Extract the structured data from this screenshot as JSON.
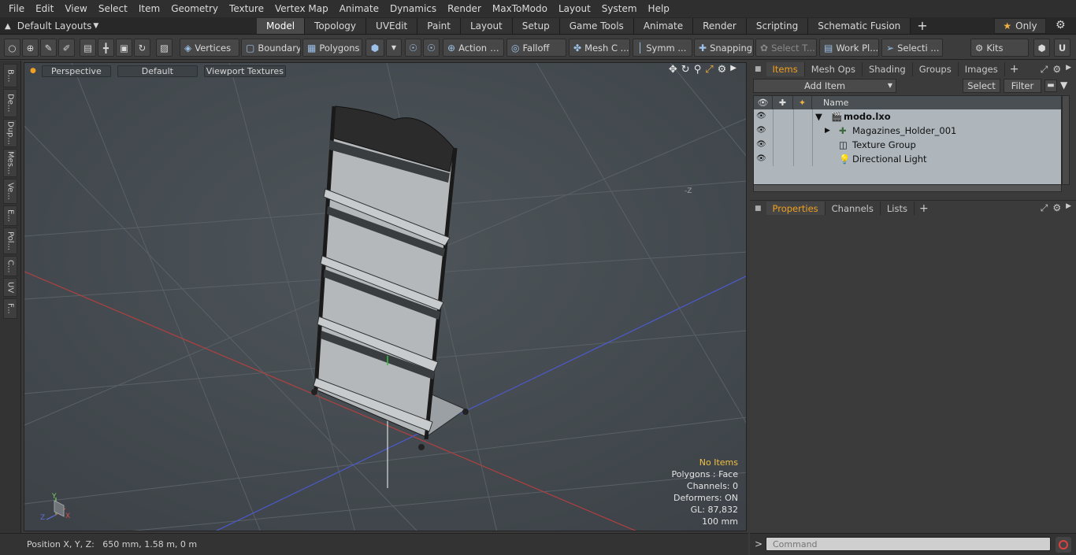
{
  "menu": [
    "File",
    "Edit",
    "View",
    "Select",
    "Item",
    "Geometry",
    "Texture",
    "Vertex Map",
    "Animate",
    "Dynamics",
    "Render",
    "MaxToModo",
    "Layout",
    "System",
    "Help"
  ],
  "layout": {
    "preset": "Default Layouts",
    "tabs": [
      "Model",
      "Topology",
      "UVEdit",
      "Paint",
      "Layout",
      "Setup",
      "Game Tools",
      "Animate",
      "Render",
      "Scripting",
      "Schematic Fusion"
    ],
    "active_tab": "Model",
    "only_label": "Only"
  },
  "toolbar": {
    "vertices": "Vertices",
    "boundary": "Boundary",
    "polygons": "Polygons",
    "action": "Action",
    "falloff": "Falloff",
    "mesh": "Mesh C ...",
    "symm": "Symm ...",
    "snapping": "Snapping",
    "select_t": "Select T...",
    "work_pl": "Work Pl...",
    "selecti": "Selecti ...",
    "kits": "Kits"
  },
  "left_tabs": [
    "B...",
    "De...",
    "Dup...",
    "Mes...",
    "Ve...",
    "E...",
    "Pol...",
    "C...",
    "UV",
    "F..."
  ],
  "viewport": {
    "view_mode": "Perspective",
    "shading": "Default",
    "textures": "Viewport Textures",
    "info": {
      "items": "No Items",
      "polygons": "Polygons : Face",
      "channels": "Channels: 0",
      "deformers": "Deformers: ON",
      "gl": "GL: 87,832",
      "scale": "100 mm"
    }
  },
  "status": "Position X, Y, Z:   650 mm, 1.58 m, 0 m",
  "items_panel": {
    "tabs": [
      "Items",
      "Mesh Ops",
      "Shading",
      "Groups",
      "Images"
    ],
    "add_item": "Add Item",
    "select": "Select",
    "filter": "Filter",
    "column_name": "Name",
    "rows": [
      {
        "label": "modo.lxo"
      },
      {
        "label": "Magazines_Holder_001"
      },
      {
        "label": "Texture Group"
      },
      {
        "label": "Directional Light"
      }
    ]
  },
  "props_panel": {
    "tabs": [
      "Properties",
      "Channels",
      "Lists"
    ]
  },
  "command": {
    "placeholder": "Command"
  },
  "colors": {
    "accent": "#f0a020",
    "viewport_bg": "#454b50",
    "list_bg": "#aeb6bc"
  }
}
